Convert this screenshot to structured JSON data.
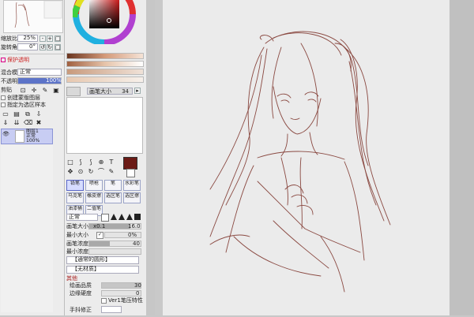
{
  "navigator": {
    "zoom_label": "缩放比率",
    "zoom_value": "25%",
    "rotate_label": "旋转角度",
    "rotate_value": "0°"
  },
  "layer_panel": {
    "protect_alpha": "保护透明",
    "blend_mode_label": "混合模式",
    "blend_mode_value": "正常",
    "opacity_label": "不透明度",
    "opacity_value": "100%",
    "clip_label": "剪贴",
    "checkbox1": "创建蒙版图层",
    "checkbox2": "指定为选区样本",
    "layer_name": "图层1",
    "layer_mode": "正常",
    "layer_opacity": "100%"
  },
  "color": {
    "main_color": "#6b1b16",
    "ring_selected": "#c0161d",
    "bars": [
      "#8a4a33",
      "#c89a7c",
      "#e7c8b0",
      "#f0e2d8"
    ],
    "swatch_label": "画笔大小",
    "swatch_value": "34"
  },
  "tools": {
    "row1": [
      "□",
      "⟆",
      "⟆",
      "⊕",
      "T"
    ],
    "row2": [
      "✥",
      "⊙",
      "↻",
      "⌒",
      "✎"
    ],
    "brushes": [
      {
        "label": "铅笔",
        "selected": true
      },
      {
        "label": "喷枪",
        "selected": false
      },
      {
        "label": "笔",
        "selected": false
      },
      {
        "label": "水彩笔",
        "selected": false
      },
      {
        "label": "马克笔",
        "selected": false
      },
      {
        "label": "橡皮擦",
        "selected": false
      },
      {
        "label": "选区笔",
        "selected": false
      },
      {
        "label": "选区擦",
        "selected": false
      },
      {
        "label": "油漆桶",
        "selected": false
      },
      {
        "label": "二值笔",
        "selected": false
      }
    ]
  },
  "brush_settings": {
    "mode_value": "正常",
    "size_label": "画笔大小",
    "size_mult": "x0.1",
    "size_value": "16.0",
    "min_size_label": "最小大小",
    "min_size_value": "0%",
    "density_label": "画笔浓度",
    "density_value": "40",
    "min_density_label": "最小浓度",
    "shape_dropdown": "【通常的圆形】",
    "texture_dropdown": "【无材质】",
    "advanced_label": "其他",
    "quality_label": "绘画品质",
    "quality_value": "30",
    "edge_label": "边缘硬度",
    "edge_value": "0",
    "ver1_label": "Ver1笔压特性",
    "stabilizer_label": "手抖修正"
  }
}
